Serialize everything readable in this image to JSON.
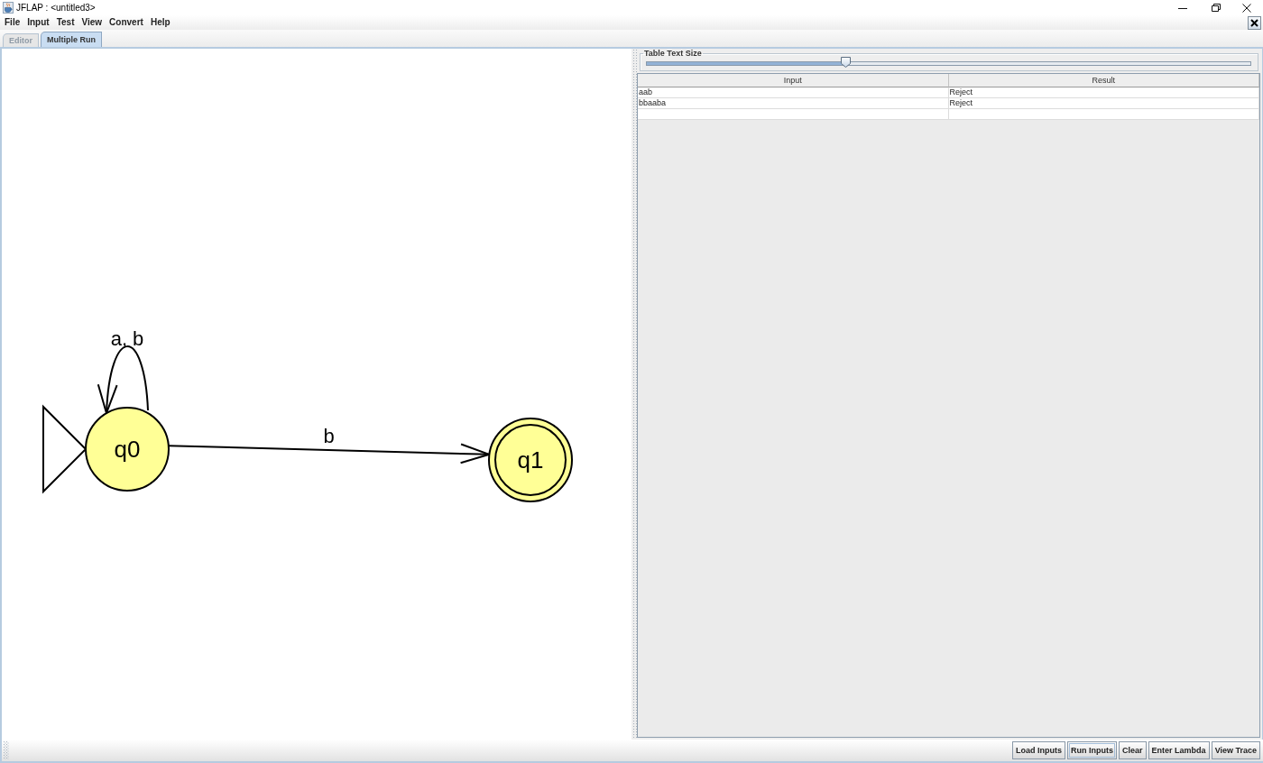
{
  "window": {
    "title": "JFLAP : <untitled3>"
  },
  "menu": [
    "File",
    "Input",
    "Test",
    "View",
    "Convert",
    "Help"
  ],
  "tabs": [
    {
      "label": "Editor",
      "selected": false,
      "disabled": true
    },
    {
      "label": "Multiple Run",
      "selected": true,
      "disabled": false
    }
  ],
  "automaton": {
    "states": [
      {
        "label": "q0",
        "initial": true,
        "final": false
      },
      {
        "label": "q1",
        "initial": false,
        "final": true
      }
    ],
    "transitions": [
      {
        "kind": "loop",
        "label": "a, b"
      },
      {
        "kind": "line",
        "label": "b"
      }
    ]
  },
  "table_text_size": {
    "label": "Table Text Size",
    "level": 0.33
  },
  "table": {
    "columns": [
      "Input",
      "Result"
    ],
    "rows": [
      {
        "input": "aab",
        "result": "Reject"
      },
      {
        "input": "bbaaba",
        "result": "Reject"
      }
    ]
  },
  "buttons": [
    {
      "label": "Load Inputs",
      "focused": false
    },
    {
      "label": "Run Inputs",
      "focused": true
    },
    {
      "label": "Clear",
      "focused": false
    },
    {
      "label": "Enter Lambda",
      "focused": false
    },
    {
      "label": "View Trace",
      "focused": false
    }
  ]
}
